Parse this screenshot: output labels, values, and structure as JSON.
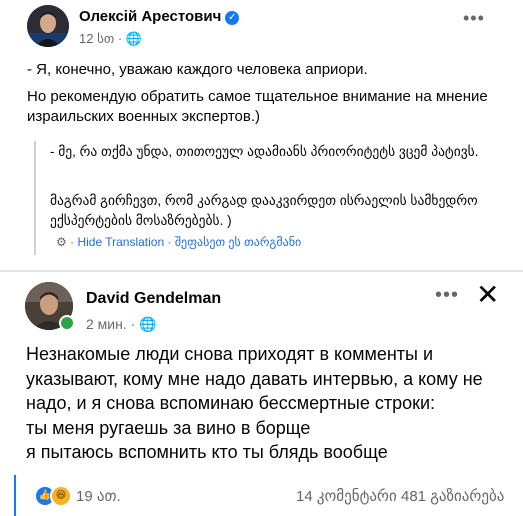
{
  "post1": {
    "author": "Олексій Арестович",
    "time": "12 სთ",
    "text_line1": "- Я, конечно, уважаю каждого человека априори.",
    "text_line2": "Но рекомендую обратить самое тщательное внимание на мнение израильских военных экспертов.)",
    "translation_line1": "- მე, რა თქმა უნდა, თითოეულ ადამიანს პრიორიტეტს ვცემ პატივს.",
    "translation_line2": "მაგრამ გირჩევთ, რომ კარგად დააკვირდეთ ისრაელის სამხედრო ექსპერტების მოსაზრებებს. )",
    "hide_translation": "Hide Translation",
    "hide_translation_ka": "შეფასეთ ეს თარგმანი"
  },
  "post2": {
    "author": "David Gendelman",
    "time": "2 мин.",
    "text": "Незнакомые люди снова приходят в комменты и указывают, кому мне надо давать интервью, а кому не надо, и я снова вспоминаю бессмертные строки:\nты меня ругаешь за вино в борще\nя пытаюсь вспомнить кто ты блядь вообще",
    "reactions_count": "19 ათ.",
    "comments": "14 კომენტარი",
    "shares": "481 გაზიარება"
  },
  "icons": {
    "verified": "verified-badge-icon",
    "globe": "globe-icon",
    "more": "more-options-icon",
    "close": "close-icon",
    "like": "like-reaction-icon",
    "haha": "haha-reaction-icon"
  },
  "colors": {
    "accent": "#1877f2",
    "online": "#31a24c",
    "muted": "#65676b"
  }
}
